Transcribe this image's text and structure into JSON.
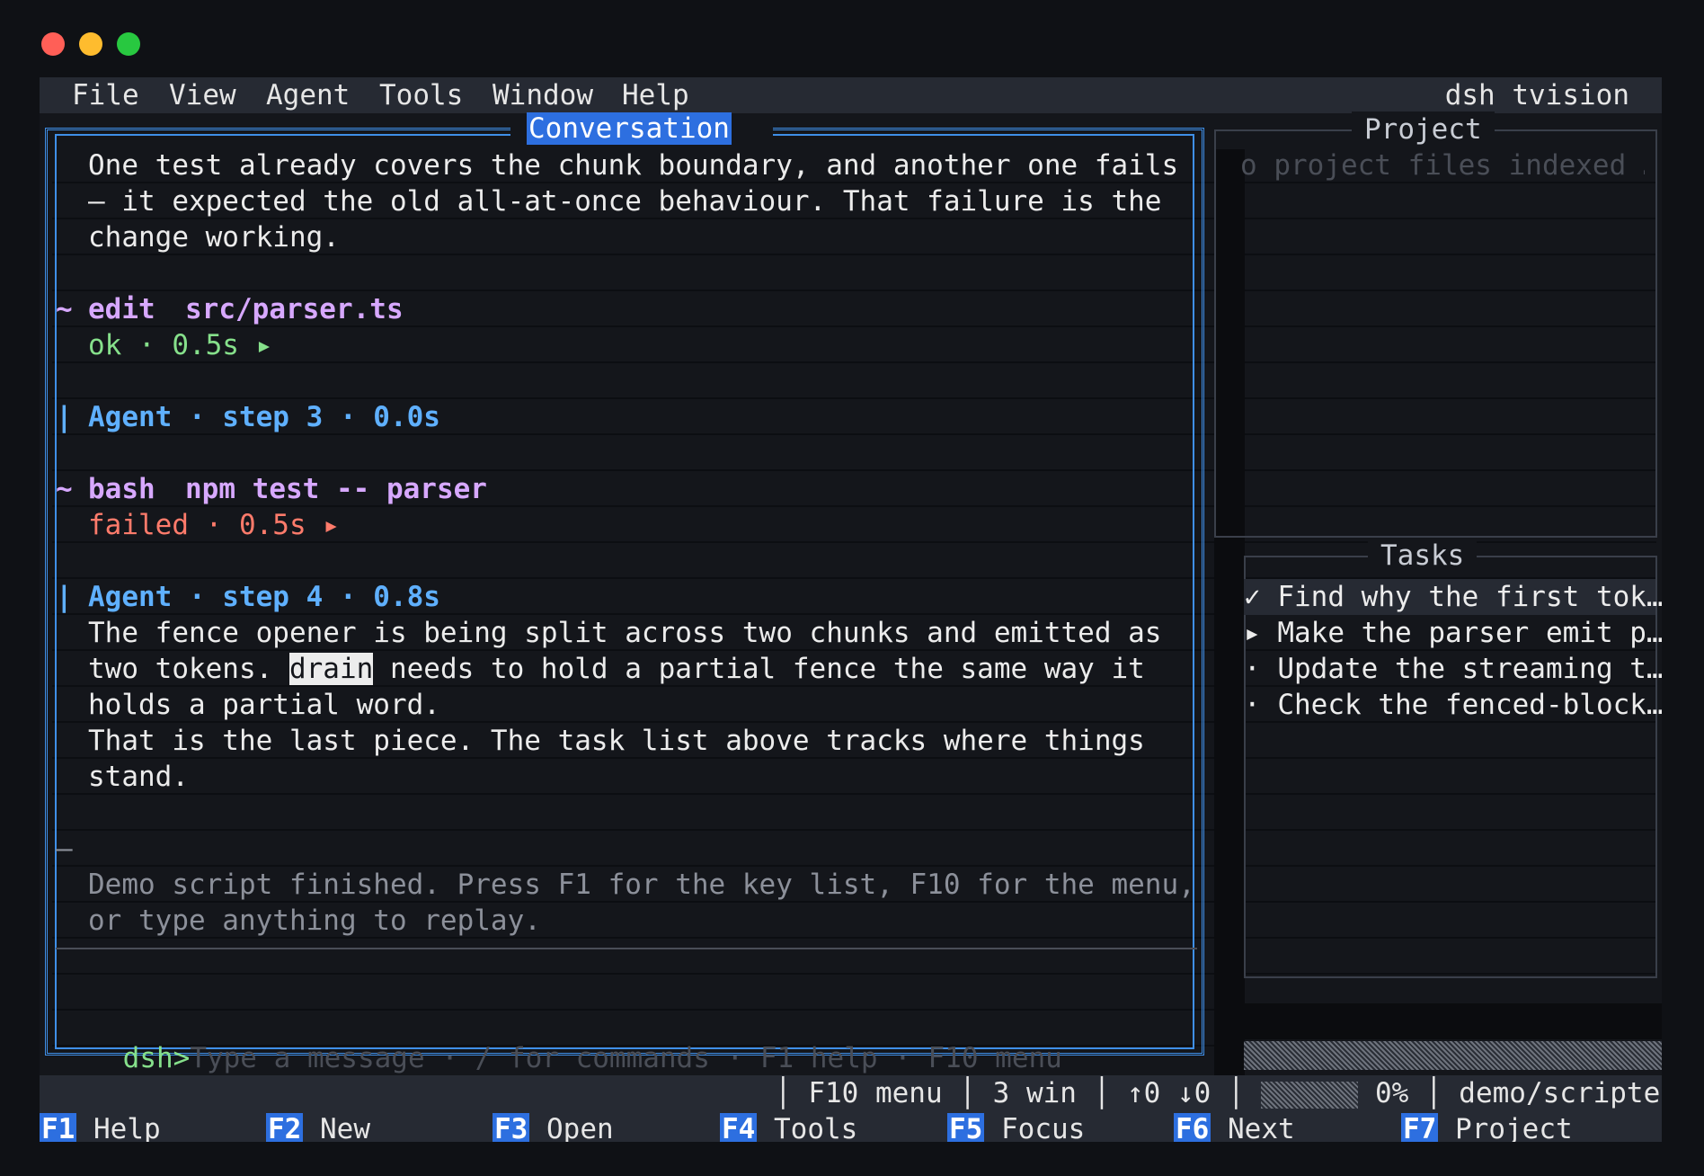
{
  "menu": {
    "items": [
      "File",
      "View",
      "Agent",
      "Tools",
      "Window",
      "Help"
    ],
    "brand": "dsh tvision"
  },
  "conversation": {
    "title": "Conversation",
    "lines": {
      "l1": "One test already covers the chunk boundary, and another one fails",
      "l2": "— it expected the old all-at-once behaviour. That failure is the",
      "l3": "change working.",
      "edit_marker": "~",
      "edit_cmd": "edit",
      "edit_arg": "src/parser.ts",
      "edit_status": "ok · 0.5s ▸",
      "agent3_bar": "|",
      "agent3": "Agent · step 3 · 0.0s",
      "bash_marker": "~",
      "bash_cmd": "bash",
      "bash_arg": "npm test -- parser",
      "bash_status": "failed · 0.5s ▸",
      "agent4_bar": "|",
      "agent4": "Agent · step 4 · 0.8s",
      "p1": "The fence opener is being split across two chunks and emitted as",
      "p2a": "two tokens. ",
      "p2_hl": "drain",
      "p2b": " needs to hold a partial fence the same way it",
      "p3": "holds a partial word.",
      "p4": "That is the last piece. The task list above tracks where things",
      "p5": "stand.",
      "dash": "–",
      "demo1": "Demo script finished. Press F1 for the key list, F10 for the menu,",
      "demo2": "or type anything to replay."
    },
    "prompt": "dsh>",
    "input_placeholder": "Type a message · / for commands · F1 help · F10 menu"
  },
  "project": {
    "title": "Project",
    "empty_text": "o project files indexed …"
  },
  "tasks": {
    "title": "Tasks",
    "items": [
      {
        "mark": "✓",
        "text": "Find why the first tok…"
      },
      {
        "mark": "▸",
        "text": "Make the parser emit p…"
      },
      {
        "mark": "·",
        "text": "Update the streaming t…"
      },
      {
        "mark": "·",
        "text": "Check the fenced-block…"
      }
    ]
  },
  "status": {
    "menu_hint": "F10 menu",
    "windows": "3 win",
    "arrows": "↑0 ↓0",
    "percent": "0%",
    "progress": 0,
    "mode": "demo/scripted"
  },
  "fkeys": [
    {
      "key": "F1",
      "label": "Help"
    },
    {
      "key": "F2",
      "label": "New"
    },
    {
      "key": "F3",
      "label": "Open"
    },
    {
      "key": "F4",
      "label": "Tools"
    },
    {
      "key": "F5",
      "label": "Focus"
    },
    {
      "key": "F6",
      "label": "Next"
    },
    {
      "key": "F7",
      "label": "Project"
    }
  ]
}
